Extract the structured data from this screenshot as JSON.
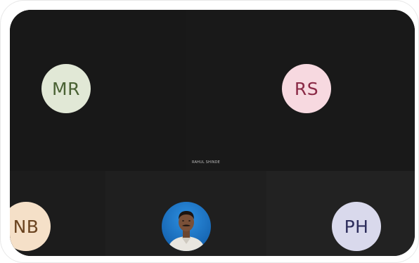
{
  "meeting": {
    "participants": [
      {
        "initials": "MR",
        "bg_color": "#e1e8d6",
        "text_color": "#4a6234"
      },
      {
        "initials": "RS",
        "bg_color": "#f7d9e0",
        "text_color": "#8a2a46"
      },
      {
        "initials": "NB",
        "bg_color": "#f5e0c8",
        "text_color": "#6b4420"
      },
      {
        "initials": "PH",
        "bg_color": "#d9d9ec",
        "text_color": "#2e2e5c"
      }
    ],
    "speaker_label": "RAHUL SHINDE",
    "camera_avatar_icon": "person-photo-icon"
  }
}
